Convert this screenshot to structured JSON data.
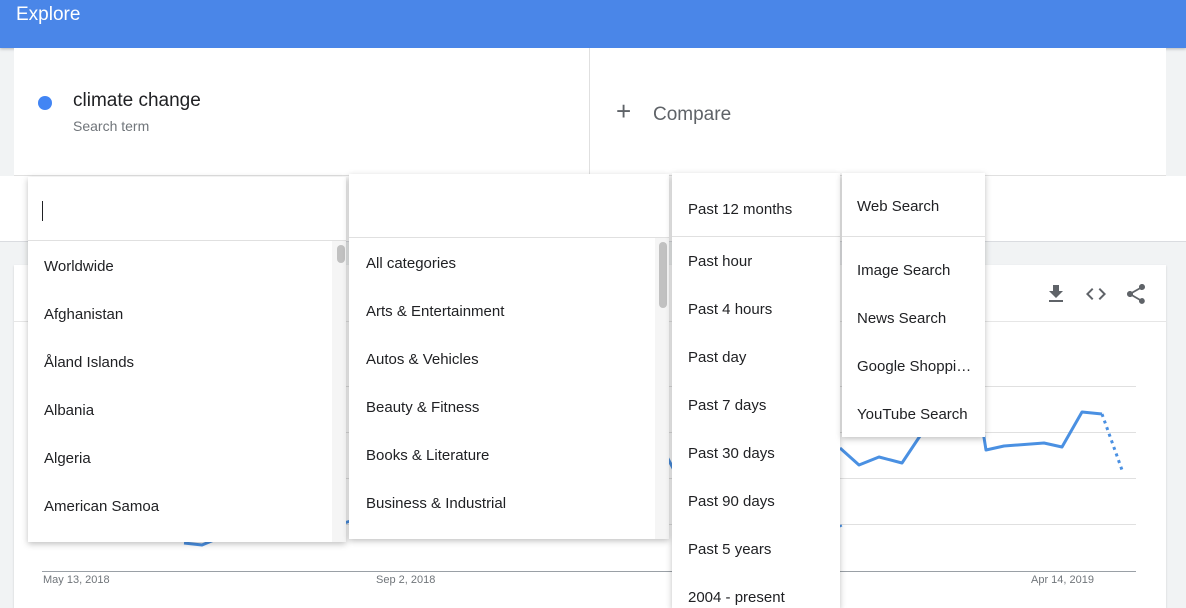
{
  "header": {
    "title": "Explore"
  },
  "term": {
    "name": "climate change",
    "type": "Search term",
    "color": "#4285f4"
  },
  "compare": {
    "label": "Compare"
  },
  "chart": {
    "x_labels": [
      "May 13, 2018",
      "Sep 2, 2018",
      "Apr 14, 2019"
    ],
    "line_color": "#4a90e2"
  },
  "region_menu": {
    "items": [
      "Worldwide",
      "Afghanistan",
      "Åland Islands",
      "Albania",
      "Algeria",
      "American Samoa"
    ]
  },
  "category_menu": {
    "items": [
      "All categories",
      "Arts & Entertainment",
      "Autos & Vehicles",
      "Beauty & Fitness",
      "Books & Literature",
      "Business & Industrial"
    ]
  },
  "time_menu": {
    "selected": "Past 12 months",
    "items": [
      "Past hour",
      "Past 4 hours",
      "Past day",
      "Past 7 days",
      "Past 30 days",
      "Past 90 days",
      "Past 5 years",
      "2004 - present"
    ]
  },
  "search_type_menu": {
    "selected": "Web Search",
    "items": [
      "Image Search",
      "News Search",
      "Google Shoppi…",
      "YouTube Search"
    ]
  }
}
